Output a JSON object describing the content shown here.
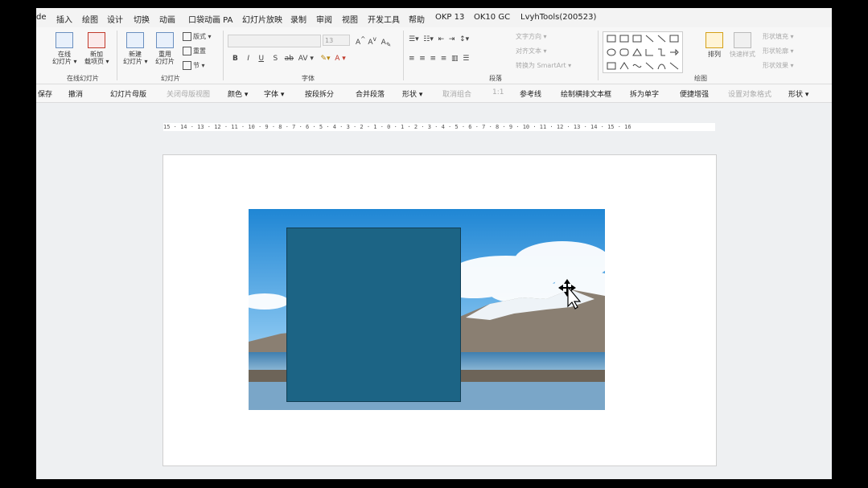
{
  "menu": [
    "de",
    "插入",
    "绘图",
    "设计",
    "切换",
    "动画",
    "口袋动画 PA",
    "幻灯片放映",
    "录制",
    "审阅",
    "视图",
    "开发工具",
    "帮助",
    "OKP 13",
    "OK10 GC",
    "LvyhTools(200523)"
  ],
  "ribbon": {
    "online_slides": {
      "btn1": "在线\n幻灯片 ▾",
      "btn2": "新加\n载项页 ▾",
      "label": "在线幻灯片"
    },
    "slides": {
      "new": "新建\n幻灯片 ▾",
      "reuse": "重用\n幻灯片",
      "layout": "版式 ▾",
      "reset": "重置",
      "section": "节 ▾",
      "label": "幻灯片"
    },
    "font": {
      "size": "13",
      "label": "字体",
      "buttons": [
        "B",
        "I",
        "U",
        "S",
        "ab",
        "AV ▾",
        "A ▾"
      ]
    },
    "paragraph": {
      "label": "段落",
      "text_dir": "文字方向 ▾",
      "align_text": "对齐文本 ▾",
      "convert": "转换为 SmartArt ▾"
    },
    "drawing": {
      "arrange": "排列",
      "quick_style": "快速样式",
      "fill": "形状填充 ▾",
      "outline": "形状轮廓 ▾",
      "effect": "形状效果 ▾",
      "label": "绘图"
    }
  },
  "qat": [
    "保存",
    "撤消",
    "幻灯片母版",
    "关闭母版视图",
    "颜色 ▾",
    "字体 ▾",
    "按段拆分",
    "合并段落",
    "形状 ▾",
    "取消组合",
    "1:1",
    "参考线",
    "绘制横排文本框",
    "拆为单字",
    "便捷增强",
    "设置对象格式",
    "形状 ▾"
  ],
  "ruler": "15 · 14 · 13 · 12 · 11 · 10 · 9 · 8 · 7 · 6 · 5 · 4 · 3 · 2 · 1 · 0 · 1 · 2 · 3 · 4 · 5 · 6 · 7 · 8 · 9 · 10 · 11 · 12 · 13 · 14 · 15 · 16",
  "colors": {
    "rectangle": "#1c6485",
    "sky_top": "#2a8fd8",
    "water": "#5b93b8"
  },
  "icons": [
    "move-cursor-icon",
    "shape-gallery-icon"
  ]
}
